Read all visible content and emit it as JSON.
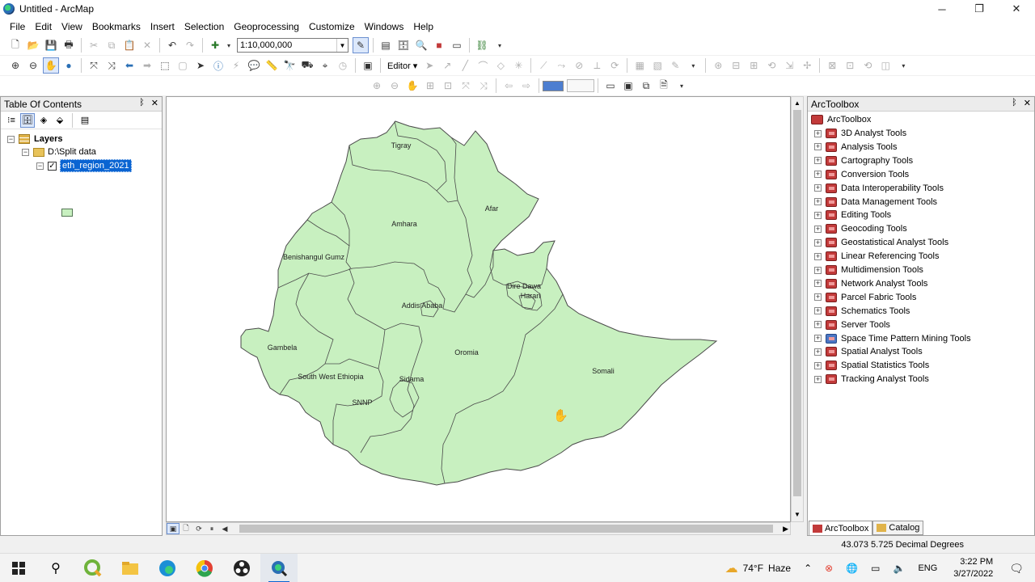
{
  "window": {
    "title": "Untitled - ArcMap",
    "minimize": "─",
    "maximize": "❐",
    "close": "✕"
  },
  "menu": [
    "File",
    "Edit",
    "View",
    "Bookmarks",
    "Insert",
    "Selection",
    "Geoprocessing",
    "Customize",
    "Windows",
    "Help"
  ],
  "toolbar": {
    "scale": "1:10,000,000",
    "editor_label": "Editor ▾"
  },
  "toc": {
    "title": "Table Of Contents",
    "pin": "ᛒ",
    "close": "✕",
    "root": "Layers",
    "folder": "D:\\Split data",
    "layer": "eth_region_2021",
    "layer_checked": "✓"
  },
  "map": {
    "regions": [
      "Tigray",
      "Afar",
      "Amhara",
      "Benishangul Gumz",
      "Dire Dawa",
      "Harari",
      "Addis Ababa",
      "Gambela",
      "Oromia",
      "Somali",
      "South West Ethiopia",
      "Sidama",
      "SNNP"
    ],
    "fill": "#c8f0c0",
    "stroke": "#4a4a4a"
  },
  "toolbox": {
    "title": "ArcToolbox",
    "root": "ArcToolbox",
    "items": [
      "3D Analyst Tools",
      "Analysis Tools",
      "Cartography Tools",
      "Conversion Tools",
      "Data Interoperability Tools",
      "Data Management Tools",
      "Editing Tools",
      "Geocoding Tools",
      "Geostatistical Analyst Tools",
      "Linear Referencing Tools",
      "Multidimension Tools",
      "Network Analyst Tools",
      "Parcel Fabric Tools",
      "Schematics Tools",
      "Server Tools",
      "Space Time Pattern Mining Tools",
      "Spatial Analyst Tools",
      "Spatial Statistics Tools",
      "Tracking Analyst Tools"
    ],
    "tabs": [
      "ArcToolbox",
      "Catalog"
    ]
  },
  "status": {
    "coords": "43.073  5.725 Decimal Degrees"
  },
  "taskbar": {
    "weather_temp": "74°F",
    "weather_desc": "Haze",
    "language": "ENG",
    "time": "3:22 PM",
    "date": "3/27/2022"
  }
}
